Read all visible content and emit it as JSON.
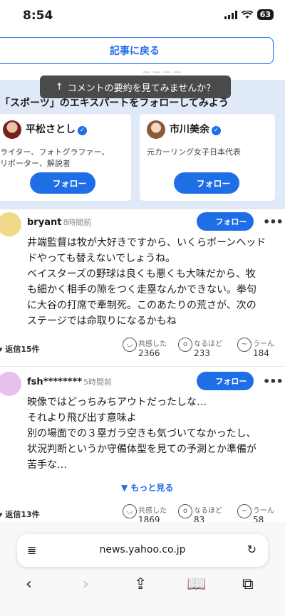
{
  "status": {
    "time": "8:54",
    "battery": "63"
  },
  "back_button": "記事に戻る",
  "toast": {
    "text": "コメントの要約を見てみませんか？"
  },
  "experts": {
    "heading": "「スポーツ」のエキスパートをフォローしてみよう",
    "cards": [
      {
        "name": "平松さとし",
        "desc_line1": "ライター、フォトグラファー、",
        "desc_line2": "リポーター、解説者",
        "follow": "フォロー"
      },
      {
        "name": "市川美余",
        "desc_line1": "元カーリング女子日本代表",
        "desc_line2": "",
        "follow": "フォロー"
      }
    ]
  },
  "comments": [
    {
      "user": "bryant",
      "time": "8時間前",
      "follow": "フォロー",
      "lines": [
        "井端監督は牧が大好きですから、いくらボーンヘッド",
        "ドやっても替えないでしょうね。",
        "ベイスターズの野球は良くも悪くも大味だから、牧",
        "も細かく相手の隙をつく走塁なんかできない。拳句",
        "に大谷の打席で牽制死。このあたりの荒さが、次の",
        "ステージでは命取りになるかもね"
      ],
      "replies": "返信15件",
      "reactions": [
        {
          "label": "共感した",
          "count": "2366"
        },
        {
          "label": "なるほど",
          "count": "233"
        },
        {
          "label": "うーん",
          "count": "184"
        }
      ]
    },
    {
      "user": "fsh********",
      "time": "5時間前",
      "follow": "フォロー",
      "lines": [
        "映像ではどっちみちアウトだったしな…",
        "それより飛び出す意味よ",
        "別の場面での３塁ガラ空きも気づいてなかったし、",
        "状況判断というか守備体型を見ての予測とか準備が",
        "苦手な…"
      ],
      "show_more": "もっと見る",
      "replies": "返信13件",
      "reactions": [
        {
          "label": "共感した",
          "count": "1869"
        },
        {
          "label": "なるほど",
          "count": "83"
        },
        {
          "label": "うーん",
          "count": "58"
        }
      ]
    }
  ],
  "browser": {
    "url": "news.yahoo.co.jp"
  }
}
